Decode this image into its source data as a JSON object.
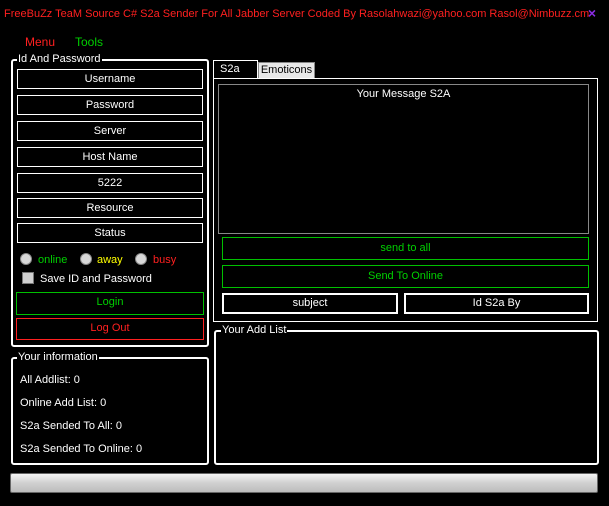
{
  "window": {
    "title": "FreeBuZz TeaM Source  C# S2a Sender For All Jabber Server Coded By Rasolahwazi@yahoo.com Rasol@Nimbuzz.cm",
    "close_glyph": "×"
  },
  "menu": {
    "menu_label": "Menu",
    "tools_label": "Tools"
  },
  "login": {
    "legend": "Id And Password",
    "fields": {
      "username": "Username",
      "password": "Password",
      "server": "Server",
      "host": "Host Name",
      "port": "5222",
      "resource": "Resource",
      "status": "Status"
    },
    "presence": {
      "online": "online",
      "away": "away",
      "busy": "busy"
    },
    "save_label": "Save ID and Password",
    "login_label": "Login",
    "logout_label": "Log Out"
  },
  "info": {
    "legend": "Your information",
    "all_addlist": "All Addlist: 0",
    "online_addlist": "Online Add List: 0",
    "s2a_all": "S2a Sended To All: 0",
    "s2a_online": "S2a Sended To Online: 0"
  },
  "tabs": {
    "s2a": "S2a",
    "emoticons": "Emoticons"
  },
  "message": {
    "text": "Your Message S2A",
    "send_all_label": "send to all",
    "send_online_label": "Send To Online",
    "subject_value": "subject",
    "id_s2a_value": "Id S2a By"
  },
  "addlist": {
    "legend": "Your Add List"
  },
  "colors": {
    "green": "#00d000",
    "red": "#ff2020",
    "yellow": "#ffff00",
    "close": "#8a2be2"
  },
  "progress": {
    "value": 0
  }
}
